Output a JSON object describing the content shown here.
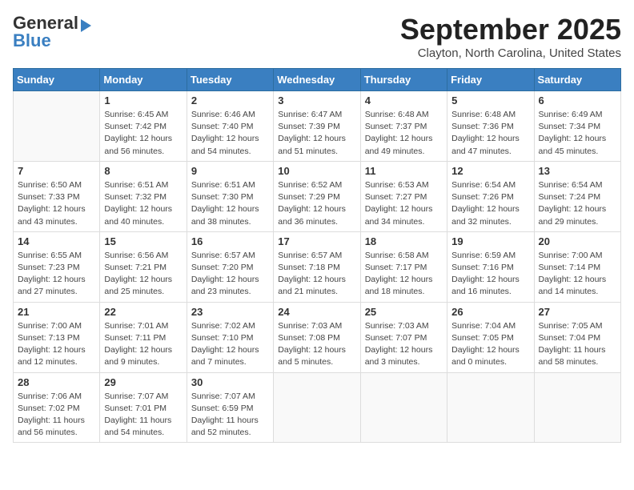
{
  "header": {
    "logo_line1": "General",
    "logo_line2": "Blue",
    "month": "September 2025",
    "location": "Clayton, North Carolina, United States"
  },
  "weekdays": [
    "Sunday",
    "Monday",
    "Tuesday",
    "Wednesday",
    "Thursday",
    "Friday",
    "Saturday"
  ],
  "weeks": [
    [
      {
        "day": "",
        "info": ""
      },
      {
        "day": "1",
        "info": "Sunrise: 6:45 AM\nSunset: 7:42 PM\nDaylight: 12 hours\nand 56 minutes."
      },
      {
        "day": "2",
        "info": "Sunrise: 6:46 AM\nSunset: 7:40 PM\nDaylight: 12 hours\nand 54 minutes."
      },
      {
        "day": "3",
        "info": "Sunrise: 6:47 AM\nSunset: 7:39 PM\nDaylight: 12 hours\nand 51 minutes."
      },
      {
        "day": "4",
        "info": "Sunrise: 6:48 AM\nSunset: 7:37 PM\nDaylight: 12 hours\nand 49 minutes."
      },
      {
        "day": "5",
        "info": "Sunrise: 6:48 AM\nSunset: 7:36 PM\nDaylight: 12 hours\nand 47 minutes."
      },
      {
        "day": "6",
        "info": "Sunrise: 6:49 AM\nSunset: 7:34 PM\nDaylight: 12 hours\nand 45 minutes."
      }
    ],
    [
      {
        "day": "7",
        "info": "Sunrise: 6:50 AM\nSunset: 7:33 PM\nDaylight: 12 hours\nand 43 minutes."
      },
      {
        "day": "8",
        "info": "Sunrise: 6:51 AM\nSunset: 7:32 PM\nDaylight: 12 hours\nand 40 minutes."
      },
      {
        "day": "9",
        "info": "Sunrise: 6:51 AM\nSunset: 7:30 PM\nDaylight: 12 hours\nand 38 minutes."
      },
      {
        "day": "10",
        "info": "Sunrise: 6:52 AM\nSunset: 7:29 PM\nDaylight: 12 hours\nand 36 minutes."
      },
      {
        "day": "11",
        "info": "Sunrise: 6:53 AM\nSunset: 7:27 PM\nDaylight: 12 hours\nand 34 minutes."
      },
      {
        "day": "12",
        "info": "Sunrise: 6:54 AM\nSunset: 7:26 PM\nDaylight: 12 hours\nand 32 minutes."
      },
      {
        "day": "13",
        "info": "Sunrise: 6:54 AM\nSunset: 7:24 PM\nDaylight: 12 hours\nand 29 minutes."
      }
    ],
    [
      {
        "day": "14",
        "info": "Sunrise: 6:55 AM\nSunset: 7:23 PM\nDaylight: 12 hours\nand 27 minutes."
      },
      {
        "day": "15",
        "info": "Sunrise: 6:56 AM\nSunset: 7:21 PM\nDaylight: 12 hours\nand 25 minutes."
      },
      {
        "day": "16",
        "info": "Sunrise: 6:57 AM\nSunset: 7:20 PM\nDaylight: 12 hours\nand 23 minutes."
      },
      {
        "day": "17",
        "info": "Sunrise: 6:57 AM\nSunset: 7:18 PM\nDaylight: 12 hours\nand 21 minutes."
      },
      {
        "day": "18",
        "info": "Sunrise: 6:58 AM\nSunset: 7:17 PM\nDaylight: 12 hours\nand 18 minutes."
      },
      {
        "day": "19",
        "info": "Sunrise: 6:59 AM\nSunset: 7:16 PM\nDaylight: 12 hours\nand 16 minutes."
      },
      {
        "day": "20",
        "info": "Sunrise: 7:00 AM\nSunset: 7:14 PM\nDaylight: 12 hours\nand 14 minutes."
      }
    ],
    [
      {
        "day": "21",
        "info": "Sunrise: 7:00 AM\nSunset: 7:13 PM\nDaylight: 12 hours\nand 12 minutes."
      },
      {
        "day": "22",
        "info": "Sunrise: 7:01 AM\nSunset: 7:11 PM\nDaylight: 12 hours\nand 9 minutes."
      },
      {
        "day": "23",
        "info": "Sunrise: 7:02 AM\nSunset: 7:10 PM\nDaylight: 12 hours\nand 7 minutes."
      },
      {
        "day": "24",
        "info": "Sunrise: 7:03 AM\nSunset: 7:08 PM\nDaylight: 12 hours\nand 5 minutes."
      },
      {
        "day": "25",
        "info": "Sunrise: 7:03 AM\nSunset: 7:07 PM\nDaylight: 12 hours\nand 3 minutes."
      },
      {
        "day": "26",
        "info": "Sunrise: 7:04 AM\nSunset: 7:05 PM\nDaylight: 12 hours\nand 0 minutes."
      },
      {
        "day": "27",
        "info": "Sunrise: 7:05 AM\nSunset: 7:04 PM\nDaylight: 11 hours\nand 58 minutes."
      }
    ],
    [
      {
        "day": "28",
        "info": "Sunrise: 7:06 AM\nSunset: 7:02 PM\nDaylight: 11 hours\nand 56 minutes."
      },
      {
        "day": "29",
        "info": "Sunrise: 7:07 AM\nSunset: 7:01 PM\nDaylight: 11 hours\nand 54 minutes."
      },
      {
        "day": "30",
        "info": "Sunrise: 7:07 AM\nSunset: 6:59 PM\nDaylight: 11 hours\nand 52 minutes."
      },
      {
        "day": "",
        "info": ""
      },
      {
        "day": "",
        "info": ""
      },
      {
        "day": "",
        "info": ""
      },
      {
        "day": "",
        "info": ""
      }
    ]
  ]
}
